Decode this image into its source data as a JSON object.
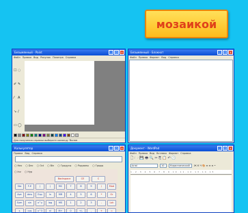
{
  "badge": {
    "text": "мозаикой"
  },
  "paint": {
    "title": "Безымянный - Paint",
    "menu": [
      "Файл",
      "Правка",
      "Вид",
      "Рисунок",
      "Палитра",
      "Справка"
    ],
    "tools": [
      "☐",
      "◌",
      "✐",
      "✎",
      "⁄",
      "A",
      "↘",
      "∕",
      "▭",
      "◯"
    ],
    "palette": [
      "#000000",
      "#808080",
      "#800000",
      "#808000",
      "#008000",
      "#008080",
      "#000080",
      "#800080",
      "#808040",
      "#004040",
      "#0080ff",
      "#004080",
      "#4000ff",
      "#804000",
      "#ffffff",
      "#c0c0c0",
      "#ff0000",
      "#ffff00",
      "#00ff00",
      "#00ffff",
      "#0000ff",
      "#ff00ff",
      "#ffff80",
      "#00ff80",
      "#80ffff",
      "#8080ff",
      "#ff0080",
      "#ff8040"
    ],
    "status": "Для получения справки выберите команду 'Вызов"
  },
  "notepad": {
    "title": "Безымянный - Блокнот",
    "menu": [
      "Файл",
      "Правка",
      "Формат",
      "Вид",
      "Справка"
    ]
  },
  "calculator": {
    "title": "Калькулятор",
    "menu": [
      "Правка",
      "Вид",
      "Справка"
    ],
    "radios_1": [
      "Hex",
      "Dec",
      "Oct",
      "Bin",
      "Градусы",
      "Радианы",
      "Грады"
    ],
    "radios_2": [
      "Inv",
      "Hyp"
    ],
    "action_buttons": [
      "Backspace",
      "CE",
      "C"
    ],
    "buttons": [
      "Sta",
      "F-E",
      "(",
      ")",
      "MC",
      "7",
      "8",
      "9",
      "/",
      "Mod",
      "Ave",
      "dms",
      "Exp",
      "ln",
      "MR",
      "4",
      "5",
      "6",
      "*",
      "Or",
      "Sum",
      "sin",
      "x^y",
      "log",
      "MS",
      "1",
      "2",
      "3",
      "-",
      "Lsh",
      "s",
      "cos",
      "x^3",
      "n!",
      "M+",
      "0",
      "+/-",
      ",",
      "+",
      "=",
      "Dat",
      "tan",
      "x^2",
      "1/x",
      "pi",
      "A",
      "B",
      "C",
      "D",
      "E"
    ]
  },
  "wordpad": {
    "title": "Документ - WordPad",
    "menu": [
      "Файл",
      "Правка",
      "Вид",
      "Вставка",
      "Формат",
      "Справка"
    ],
    "toolbar_icons": "🗋 🗁 💾 🖶 🔍 ✂ ⎘ 📋 ↶ 🕒",
    "font": "Arial",
    "size": "10",
    "script": "Кириллический",
    "format_icons": "Ж К Ч 🎨 ≡ ≡ ≡ •",
    "ruler": "1·2·3·4·5·6·7·8·9·10·11·12·13·14·15"
  }
}
